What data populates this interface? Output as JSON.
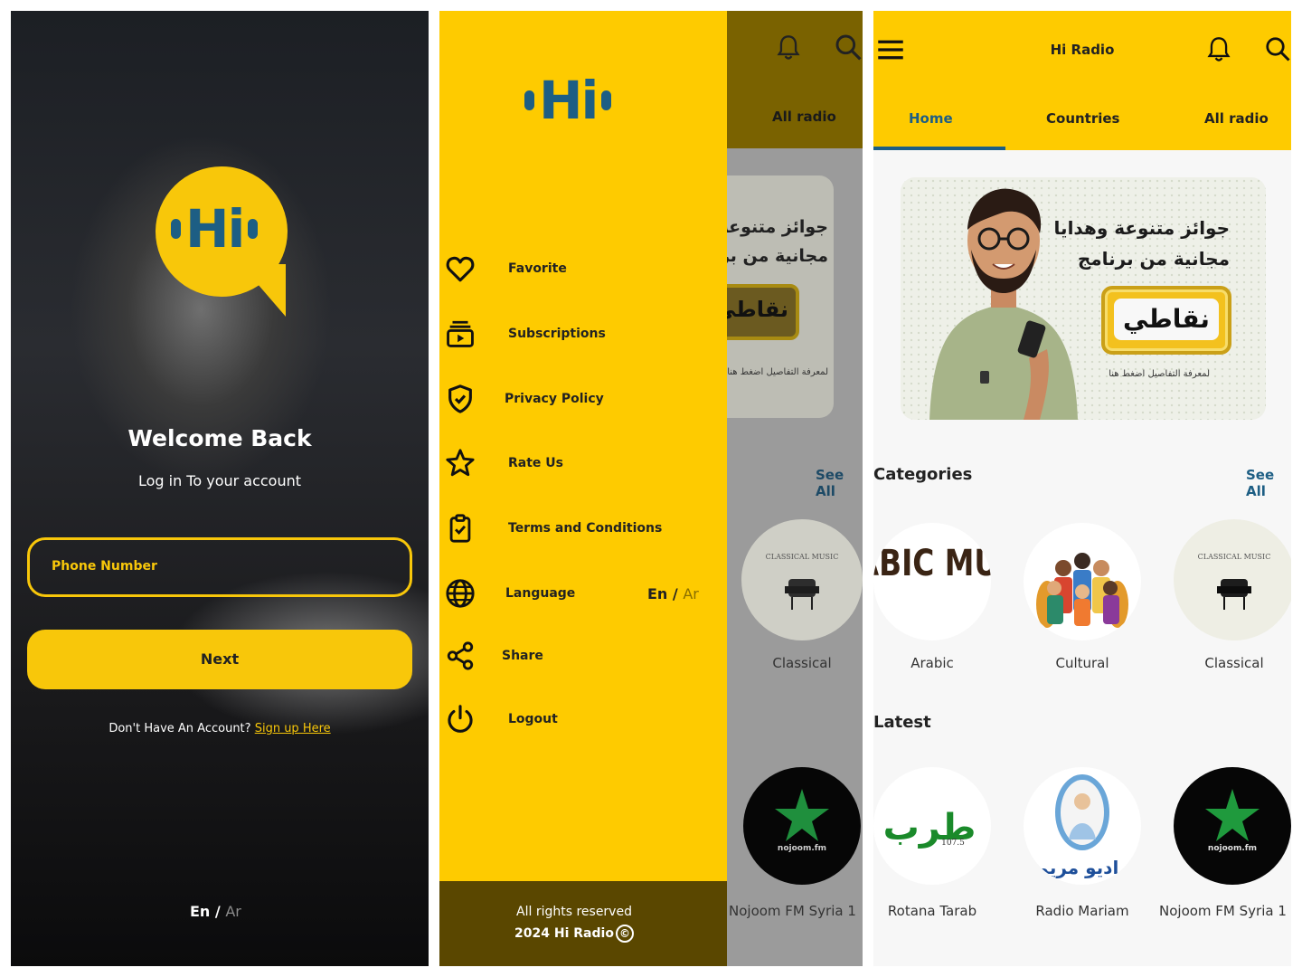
{
  "brand": {
    "logo_text": "Hi",
    "yellow": "#fecb00",
    "blue": "#1d5e84",
    "dark_footer": "#5a4700"
  },
  "login": {
    "title": "Welcome Back",
    "subtitle": "Log in To your account",
    "phone_placeholder": "Phone Number",
    "next_label": "Next",
    "no_account_text": "Don't Have An Account?",
    "signup_link": "Sign up Here",
    "lang_en": "En",
    "lang_sep": "/",
    "lang_ar": "Ar"
  },
  "drawer": {
    "items": [
      {
        "label": "Favorite",
        "icon": "heart-icon"
      },
      {
        "label": "Subscriptions",
        "icon": "subscriptions-icon"
      },
      {
        "label": "Privacy Policy",
        "icon": "shield-check-icon"
      },
      {
        "label": "Rate Us",
        "icon": "star-icon"
      },
      {
        "label": "Terms and Conditions",
        "icon": "clipboard-check-icon"
      },
      {
        "label": "Language",
        "icon": "globe-icon"
      },
      {
        "label": "Share",
        "icon": "share-icon"
      },
      {
        "label": "Logout",
        "icon": "power-icon"
      }
    ],
    "language_en": "En",
    "language_sep": "/",
    "language_ar": "Ar",
    "footer_line1": "All rights reserved",
    "footer_line2": "2024 Hi Radio",
    "footer_symbol": "©",
    "behind": {
      "tab_label": "All radio",
      "see_all": "See All",
      "category_label": "Classical",
      "latest_label": "Nojoom FM Syria 1"
    }
  },
  "home": {
    "app_title": "Hi Radio",
    "tabs": [
      "Home",
      "Countries",
      "All radio"
    ],
    "active_tab": "Home",
    "banner": {
      "line1": "جوائز متنوعة وهدايا",
      "line2": "مجانية من برنامج",
      "badge": "نقاطي",
      "footnote": "لمعرفة التفاصيل اضغط هنا"
    },
    "categories_title": "Categories",
    "see_all": "See All",
    "categories": [
      {
        "label": "Arabic",
        "art_text": "ARABIC MUSIC"
      },
      {
        "label": "Cultural"
      },
      {
        "label": "Classical",
        "art_text": "CLASSICAL MUSIC"
      }
    ],
    "latest_title": "Latest",
    "latest": [
      {
        "label": "Rotana Tarab",
        "art_text": "طرب",
        "freq": "107.5"
      },
      {
        "label": "Radio Mariam",
        "art_text": "راديو مريم"
      },
      {
        "label": "Nojoom FM Syria 1",
        "art_text": "nojoom.fm"
      }
    ]
  }
}
